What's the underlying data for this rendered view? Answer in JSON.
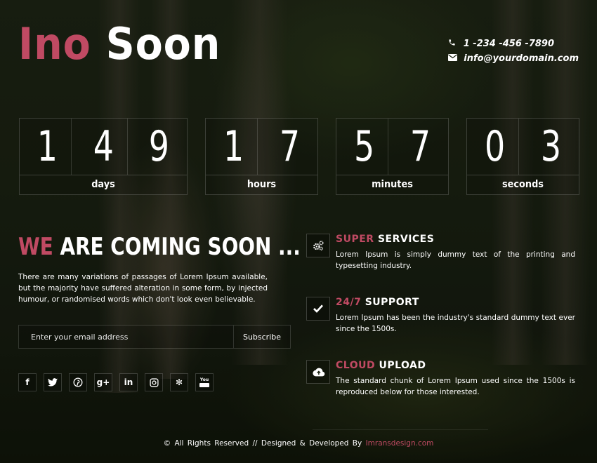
{
  "brand": {
    "part1": "Ino",
    "part2": "Soon",
    "accent_color": "#c04a63"
  },
  "contact": {
    "phone_icon": "phone-icon",
    "phone": "1 -234 -456 -7890",
    "email_icon": "envelope-icon",
    "email": "info@yourdomain.com"
  },
  "countdown": [
    {
      "digits": [
        "1",
        "4",
        "9"
      ],
      "label": "days"
    },
    {
      "digits": [
        "1",
        "7"
      ],
      "label": "hours"
    },
    {
      "digits": [
        "5",
        "7"
      ],
      "label": "minutes"
    },
    {
      "digits": [
        "0",
        "3"
      ],
      "label": "seconds"
    }
  ],
  "intro": {
    "heading_accent": "WE",
    "heading_rest": "ARE COMING SOON ...",
    "paragraph": "There are many variations of passages of Lorem Ipsum available, but the majority have suffered alteration in some form, by injected humour, or randomised words which don't look even believable."
  },
  "subscribe": {
    "placeholder": "Enter your email address",
    "button": "Subscribe"
  },
  "social": [
    {
      "icon": "facebook-icon",
      "glyph": "f"
    },
    {
      "icon": "twitter-icon",
      "glyph": "t"
    },
    {
      "icon": "pinterest-icon",
      "glyph": "p"
    },
    {
      "icon": "google-plus-icon",
      "glyph": "g+"
    },
    {
      "icon": "linkedin-icon",
      "glyph": "in"
    },
    {
      "icon": "instagram-icon",
      "glyph": "◙"
    },
    {
      "icon": "yelp-icon",
      "glyph": "✻"
    },
    {
      "icon": "youtube-icon",
      "glyph": "You"
    }
  ],
  "services": [
    {
      "icon": "cogs-icon",
      "accent": "SUPER",
      "title": "SERVICES",
      "desc": "Lorem Ipsum is simply dummy text of the printing and typesetting industry."
    },
    {
      "icon": "check-icon",
      "accent": "24/7",
      "title": "SUPPORT",
      "desc": "Lorem Ipsum has been the industry's standard dummy text ever since the 1500s."
    },
    {
      "icon": "cloud-upload-icon",
      "accent": "CLOUD",
      "title": "UPLOAD",
      "desc": "The standard chunk of Lorem Ipsum used since the 1500s is reproduced below for those interested."
    }
  ],
  "footer": {
    "text": "© All Rights Reserved // Designed & Developed By",
    "link": "Imransdesign.com"
  }
}
